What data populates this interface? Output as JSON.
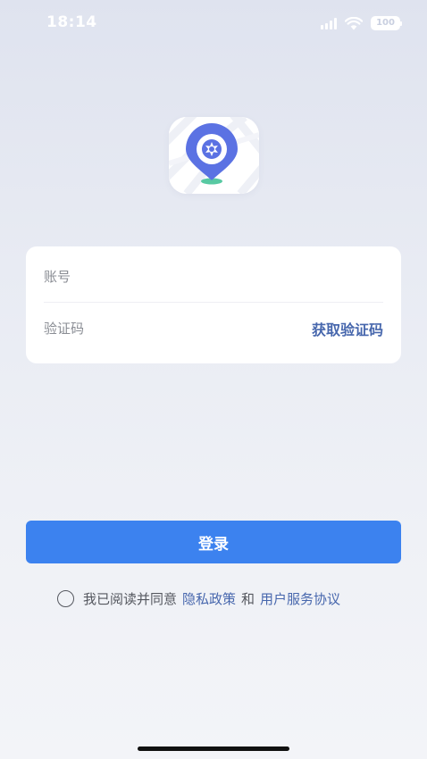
{
  "status_bar": {
    "time": "18:14",
    "battery_level": "100",
    "icons": [
      "signal-icon",
      "wifi-icon",
      "battery-icon"
    ]
  },
  "logo": {
    "icon": "map-pin-logo-icon",
    "colors": {
      "pin": "#5b72e3",
      "base": "#58c9a2"
    }
  },
  "form": {
    "account_placeholder": "账号",
    "account_value": "",
    "code_placeholder": "验证码",
    "code_value": "",
    "get_code_label": "获取验证码"
  },
  "login": {
    "label": "登录",
    "color": "#3c82ef"
  },
  "agreement": {
    "checked": false,
    "prefix": "我已阅读并同意",
    "privacy_link": "隐私政策",
    "conjunction": "和",
    "terms_link": "用户服务协议",
    "link_color": "#4767ad"
  }
}
